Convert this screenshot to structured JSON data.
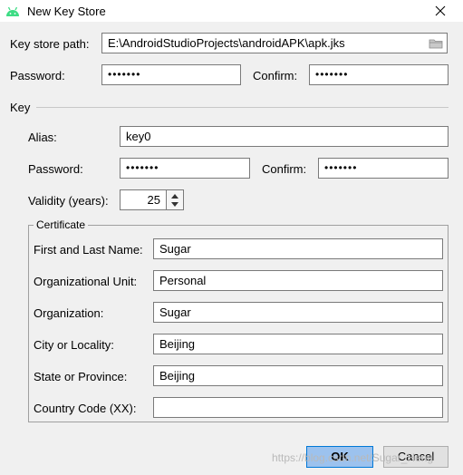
{
  "window": {
    "title": "New Key Store"
  },
  "keystore": {
    "path_label": "Key store path:",
    "path_value": "E:\\AndroidStudioProjects\\androidAPK\\apk.jks",
    "password_label": "Password:",
    "password_value": "•••••••",
    "confirm_label": "Confirm:",
    "confirm_value": "•••••••"
  },
  "key": {
    "section_label": "Key",
    "alias_label": "Alias:",
    "alias_value": "key0",
    "password_label": "Password:",
    "password_value": "•••••••",
    "confirm_label": "Confirm:",
    "confirm_value": "•••••••",
    "validity_label": "Validity (years):",
    "validity_value": "25"
  },
  "certificate": {
    "section_label": "Certificate",
    "fields": [
      {
        "label": "First and Last Name:",
        "value": "Sugar"
      },
      {
        "label": "Organizational Unit:",
        "value": "Personal"
      },
      {
        "label": "Organization:",
        "value": "Sugar"
      },
      {
        "label": "City or Locality:",
        "value": "Beijing"
      },
      {
        "label": "State or Province:",
        "value": "Beijing"
      },
      {
        "label": "Country Code (XX):",
        "value": ""
      }
    ]
  },
  "buttons": {
    "ok_label": "OK",
    "cancel_label": "Cancel"
  },
  "watermark": "https://blog.csdn.net/Sugar_Heng",
  "icons": {
    "app": "android-icon",
    "close": "close-icon",
    "browse": "folder-icon",
    "spin_up": "spinner-up-icon",
    "spin_down": "spinner-down-icon"
  },
  "colors": {
    "android_green": "#3ddc84",
    "ok_button": "#9cc2ee",
    "ok_border": "#0078d7"
  }
}
